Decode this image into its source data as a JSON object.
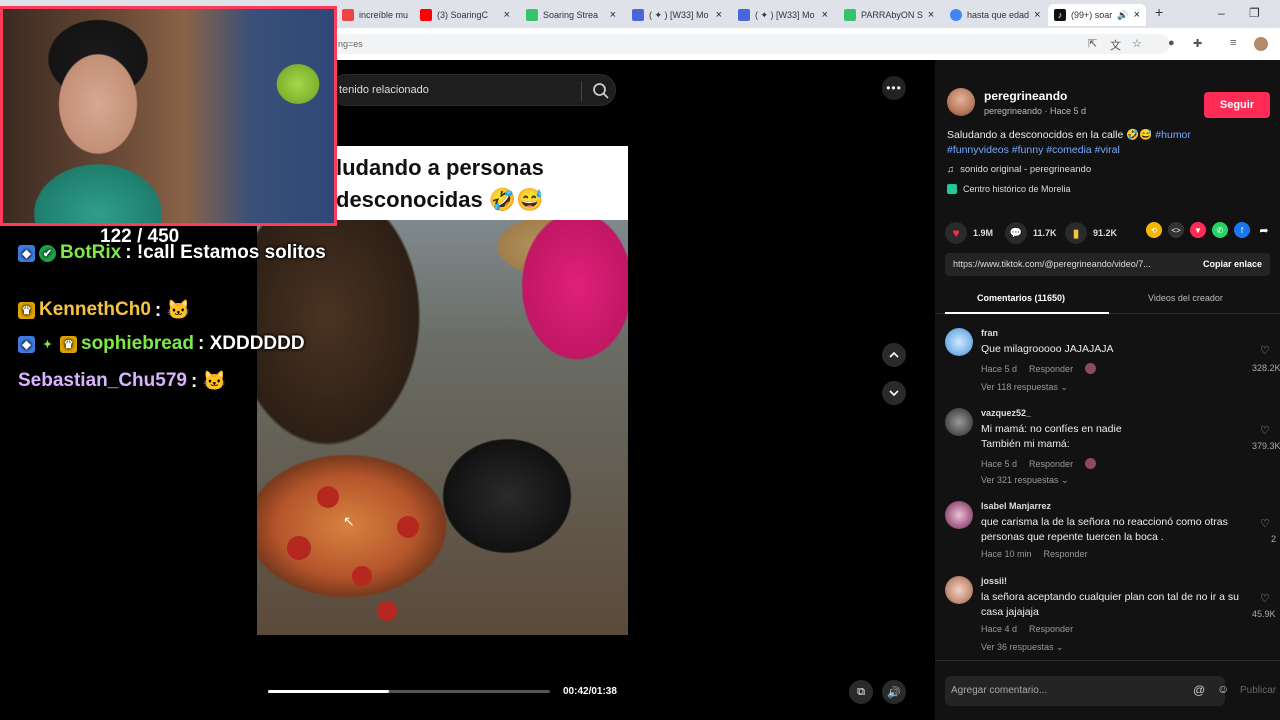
{
  "browser": {
    "tabs": [
      {
        "label": "increíble mu",
        "color": "#e44"
      },
      {
        "label": "(3) SoaringC",
        "color": "#f00"
      },
      {
        "label": "Soaring Strea",
        "color": "#36c36c"
      },
      {
        "label": "( ✦ ) [W33] Mo",
        "color": "#4a66d8"
      },
      {
        "label": "( ✦ ) [W33] Mo",
        "color": "#4a66d8"
      },
      {
        "label": "PARRAbyON S",
        "color": "#36c36c"
      },
      {
        "label": "hasta que edad",
        "color": "#4285f4"
      },
      {
        "label": "(99+) soar",
        "color": "#111"
      }
    ],
    "url": "ng=es"
  },
  "search": {
    "placeholder": "tenido relacionado"
  },
  "video": {
    "caption": "ludando a personas\ndesconocidas 🤣😅",
    "current_time": "00:42",
    "duration": "01:38",
    "time_display": "00:42/01:38",
    "progress": 0.43
  },
  "stream": {
    "counter": "122 / 450",
    "chat": [
      {
        "user": "BotRix",
        "user_color": "#7ee84a",
        "message": ": !call Estamos solitos",
        "badges": [
          "◆",
          "✔"
        ]
      },
      {
        "user": "KennethCh0",
        "user_color": "#f5c542",
        "message": ": 🐱",
        "badges": [
          "♛"
        ]
      },
      {
        "user": "sophiebread",
        "user_color": "#7ee84a",
        "message": ": XDDDDDD",
        "badges": [
          "◆",
          "✦",
          "♛"
        ]
      },
      {
        "user": "Sebastian_Chu579",
        "user_color": "#d9b3ff",
        "message": ": 🐱",
        "badges": []
      }
    ]
  },
  "post": {
    "author": "peregrineando",
    "author_sub": "peregrineando · Hace 5 d",
    "follow_label": "Seguir",
    "description": "Saludando a desconocidos en la calle 🤣😅",
    "hashtags_line1": "#humor",
    "hashtags_line2": "#funnyvideos #funny #comedia #viral",
    "sound": "sonido original - peregrineando",
    "location": "Centro histórico de Morelia",
    "likes": "1.9M",
    "comments_count": "11.7K",
    "saves": "91.2K",
    "link": "https://www.tiktok.com/@peregrineando/video/7...",
    "copy_label": "Copiar enlace",
    "tab_comments": "Comentarios (11650)",
    "tab_videos": "Videos del creador",
    "input_placeholder": "Agregar comentario...",
    "post_label": "Publicar"
  },
  "comments": [
    {
      "user": "fran",
      "text": "Que milagrooooo JAJAJAJA",
      "time": "Hace 5 d",
      "reply": "Responder",
      "more": "Ver 118 respuestas ⌄",
      "likes": "328.2K"
    },
    {
      "user": "vazquez52_",
      "text": "Mi mamá: no confíes en nadie\nTambién mi mamá:",
      "time": "Hace 5 d",
      "reply": "Responder",
      "more": "Ver 321 respuestas ⌄",
      "likes": "379.3K"
    },
    {
      "user": "Isabel Manjarrez",
      "text": "que carisma la de la señora no reaccionó como otras personas que repente tuercen la boca .",
      "time": "Hace 10 min",
      "reply": "Responder",
      "more": "",
      "likes": "2"
    },
    {
      "user": "jossii!",
      "text": "la señora aceptando cualquier plan con tal de no ir a su casa jajajaja",
      "time": "Hace 4 d",
      "reply": "Responder",
      "more": "Ver 36 respuestas ⌄",
      "likes": "45.9K"
    }
  ]
}
